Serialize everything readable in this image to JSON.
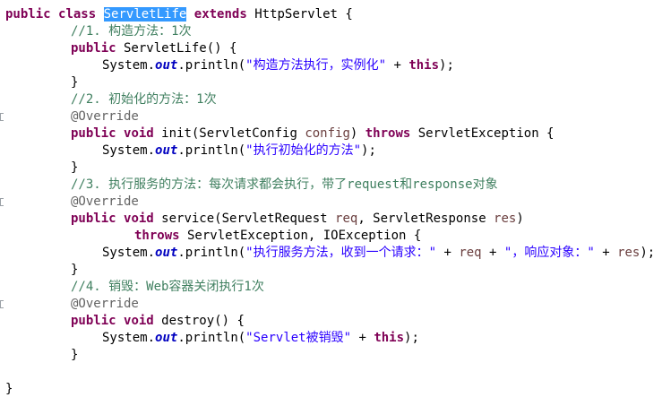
{
  "code": {
    "l1": {
      "kw_public": "public",
      "kw_class": "class",
      "class_name": "ServletLife",
      "kw_extends": "extends",
      "rest": " HttpServlet {"
    },
    "l2": {
      "comment": "//1. 构造方法：1次"
    },
    "l3": {
      "kw_public": "public",
      "rest": " ServletLife() {"
    },
    "l4": {
      "a": "System.",
      "field": "out",
      "b": ".println(",
      "string": "\"构造方法执行，实例化\"",
      "c": " + ",
      "kw_this": "this",
      "d": ");"
    },
    "l5": {
      "brace": "}"
    },
    "l6": {
      "comment": "//2. 初始化的方法：1次"
    },
    "l7": {
      "annotation": "@Override"
    },
    "l8": {
      "kw_public": "public",
      "kw_void": "void",
      "a": " init(ServletConfig ",
      "param": "config",
      "b": ") ",
      "kw_throws": "throws",
      "c": " ServletException {"
    },
    "l9": {
      "a": "System.",
      "field": "out",
      "b": ".println(",
      "string": "\"执行初始化的方法\"",
      "c": ");"
    },
    "l10": {
      "brace": "}"
    },
    "l11": {
      "comment": "//3. 执行服务的方法：每次请求都会执行，带了request和response对象"
    },
    "l12": {
      "annotation": "@Override"
    },
    "l13": {
      "kw_public": "public",
      "kw_void": "void",
      "a": " service(ServletRequest ",
      "param1": "req",
      "b": ", ServletResponse ",
      "param2": "res",
      "c": ")"
    },
    "l14": {
      "kw_throws": "throws",
      "a": " ServletException, IOException {"
    },
    "l15": {
      "a": "System.",
      "field": "out",
      "b": ".println(",
      "string1": "\"执行服务方法，收到一个请求：\"",
      "c": " + ",
      "param1": "req",
      "d": " + ",
      "string2": "\"，响应对象：\"",
      "e": " + ",
      "param2": "res",
      "f": ");"
    },
    "l16": {
      "brace": "}"
    },
    "l17": {
      "comment": "//4. 销毁：Web容器关闭执行1次"
    },
    "l18": {
      "annotation": "@Override"
    },
    "l19": {
      "kw_public": "public",
      "kw_void": "void",
      "a": " destroy() {"
    },
    "l20": {
      "a": "System.",
      "field": "out",
      "b": ".println(",
      "string": "\"Servlet被销毁\"",
      "c": " + ",
      "kw_this": "this",
      "d": ");"
    },
    "l21": {
      "brace": "}"
    },
    "l23": {
      "brace": "}"
    }
  },
  "colors": {
    "keyword": "#7f0055",
    "comment": "#3f7f5f",
    "annotation": "#646464",
    "string": "#2a00ff",
    "field": "#0000c0",
    "parameter": "#6a3e3e",
    "selection": "#3399ff"
  }
}
